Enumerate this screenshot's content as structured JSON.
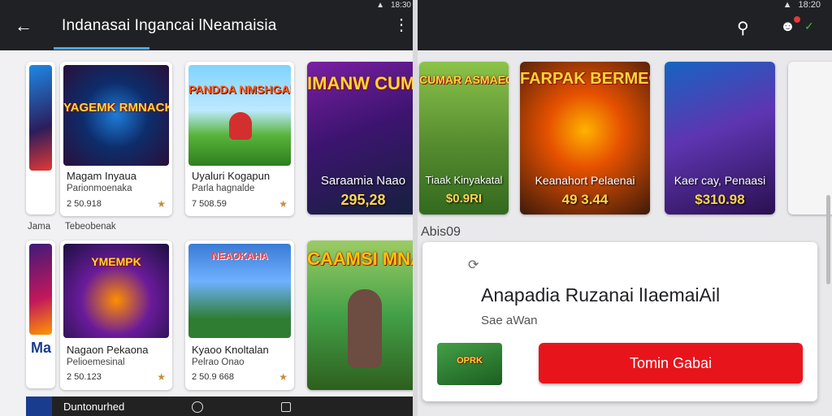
{
  "left_pane": {
    "status": {
      "time": "18:30"
    },
    "app_bar": {
      "back_icon": "arrow-left-icon",
      "title": "Indanasai Ingancai lNeamaisia",
      "more_icon": "more-vertical-icon"
    },
    "section_label_1": "Tebeobenak",
    "section_label_left_1": "Jama",
    "row1": [
      {
        "art_text": "YAGEMK RMNACK",
        "name": "Magam Inyaua",
        "sub": "Parionmoenaka",
        "rating": "2 50.918"
      },
      {
        "art_text": "PANDDA NMSHGALS",
        "name": "Uyaluri Kogapun",
        "sub": "Parla hagnalde",
        "rating": "7 508.59"
      }
    ],
    "poster1": {
      "art_text": "IMANW CUMNA",
      "title": "Saraamia Naao",
      "price": "295,28"
    },
    "row2": [
      {
        "art_text": "YMEMPK",
        "name": "Nagaon Pekaona",
        "sub": "Pelioemesinal",
        "rating": "2 50.123"
      },
      {
        "art_text": "NEAOKAHA",
        "name": "Kyaoo Knoltalan",
        "sub": "Pelrao Onao",
        "rating": "2 50.9 668"
      }
    ],
    "poster2": {
      "art_text": "CAAMSI MNAUM"
    },
    "left_edge_label": "Ma",
    "nav": {
      "label": "Duntonurhed",
      "home_icon": "circle-home-icon",
      "recent_icon": "square-recents-icon"
    }
  },
  "right_pane": {
    "status": {
      "time": "18:20"
    },
    "app_bar": {
      "search_icon": "search-icon",
      "account_icon": "account-badge-icon",
      "check_icon": "check-icon"
    },
    "posters": [
      {
        "art_text": "CUMAR ASMAEGAEN",
        "title": "Tiaak Kinyakatal",
        "price": "$0.9RI"
      },
      {
        "art_text": "FARPAK BERMEGH",
        "title": "Keanahort Pelaenai",
        "price": "49 3.44"
      },
      {
        "art_text": "",
        "title": "Kaer cay, Penaasi",
        "price": "$310.98"
      }
    ],
    "apps_label": "Abis09",
    "dialog": {
      "icon": "refresh-spinner-icon",
      "title": "Anapadia Ruzanai lIaemaiAil",
      "subtitle": "Sae aWan",
      "thumb_text": "OPRK",
      "button_label": "Tomin Gabai"
    }
  },
  "colors": {
    "app_bar": "#202124",
    "accent_tab": "#4aa3ff",
    "cta_red": "#e8141c",
    "star": "#c98b3a"
  }
}
